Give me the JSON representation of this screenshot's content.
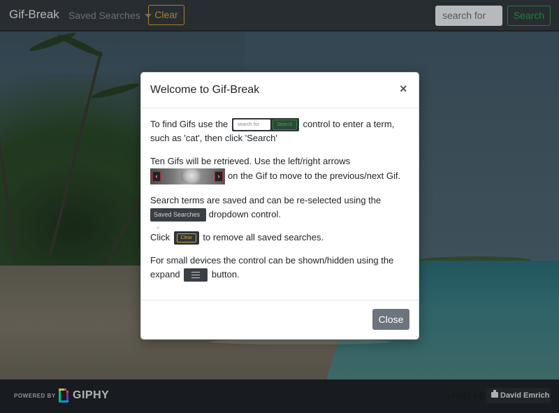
{
  "navbar": {
    "brand": "Gif-Break",
    "saved_searches_label": "Saved Searches",
    "clear_label": "Clear",
    "search_placeholder": "search for",
    "search_label": "Search"
  },
  "modal": {
    "title": "Welcome to Gif-Break",
    "close_symbol": "×",
    "p1_before": "To find Gifs use the",
    "p1_after": "control to enter a term, such as 'cat', then click 'Search'",
    "p2_before": "Ten Gifs will be retrieved. Use the left/right arrows",
    "p2_after": "on the Gif to move to the previous/next Gif.",
    "p3_before": "Search terms are saved and can be re-selected using the",
    "p3_after": "dropdown control.",
    "p4_before": "Click",
    "p4_after": "to remove all saved searches.",
    "p5_before": "For small devices the control can be shown/hidden using the expand",
    "p5_after": "button.",
    "close_button": "Close",
    "mini_search_placeholder": "search for",
    "mini_search_button": "Search",
    "mini_saved_searches": "Saved Searches",
    "mini_clear": "Clear",
    "mini_left_arrow": "‹",
    "mini_right_arrow": "›"
  },
  "footer": {
    "powered_by": "POWERED BY",
    "giphy": "GIPHY",
    "photo_by": "photo by",
    "author": "David Emrich"
  },
  "colors": {
    "navbar_bg": "#343a40",
    "clear_accent": "#d8a630",
    "search_accent": "#29a14a",
    "close_button_bg": "#6c757d"
  },
  "icons": [
    "caret-down-icon",
    "close-icon",
    "camera-icon",
    "giphy-logo-icon",
    "hamburger-icon",
    "chevron-left-icon",
    "chevron-right-icon"
  ]
}
